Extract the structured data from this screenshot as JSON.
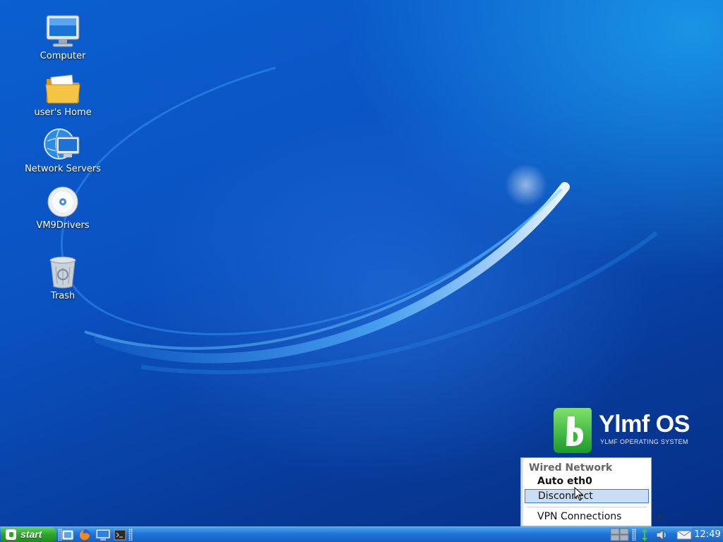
{
  "desktop": {
    "icons": [
      {
        "label": "Computer",
        "icon": "computer-icon"
      },
      {
        "label": "user's Home",
        "icon": "folder-icon"
      },
      {
        "label": "Network Servers",
        "icon": "network-icon"
      },
      {
        "label": "VM9Drivers",
        "icon": "cd-icon"
      },
      {
        "label": "Trash",
        "icon": "trash-icon"
      }
    ],
    "brand": {
      "title": "Ylmf OS",
      "subtitle": "YLMF OPERATING SYSTEM",
      "color": "#39b43a"
    }
  },
  "network_menu": {
    "header": "Wired Network",
    "connection": "Auto eth0",
    "disconnect": "Disconnect",
    "vpn": "VPN Connections"
  },
  "taskbar": {
    "start_label": "start",
    "quick_launch": [
      "files-icon",
      "firefox-icon",
      "desktop-icon",
      "terminal-icon"
    ],
    "tray": [
      "workspace-switcher-icon",
      "network-icon",
      "volume-icon",
      "mail-icon"
    ],
    "clock": "12:49"
  },
  "colors": {
    "desktop_blue": "#0a52c2",
    "taskbar_blue": "#1f74d6",
    "start_green": "#2ea52a",
    "menu_highlight": "#c9def5"
  }
}
